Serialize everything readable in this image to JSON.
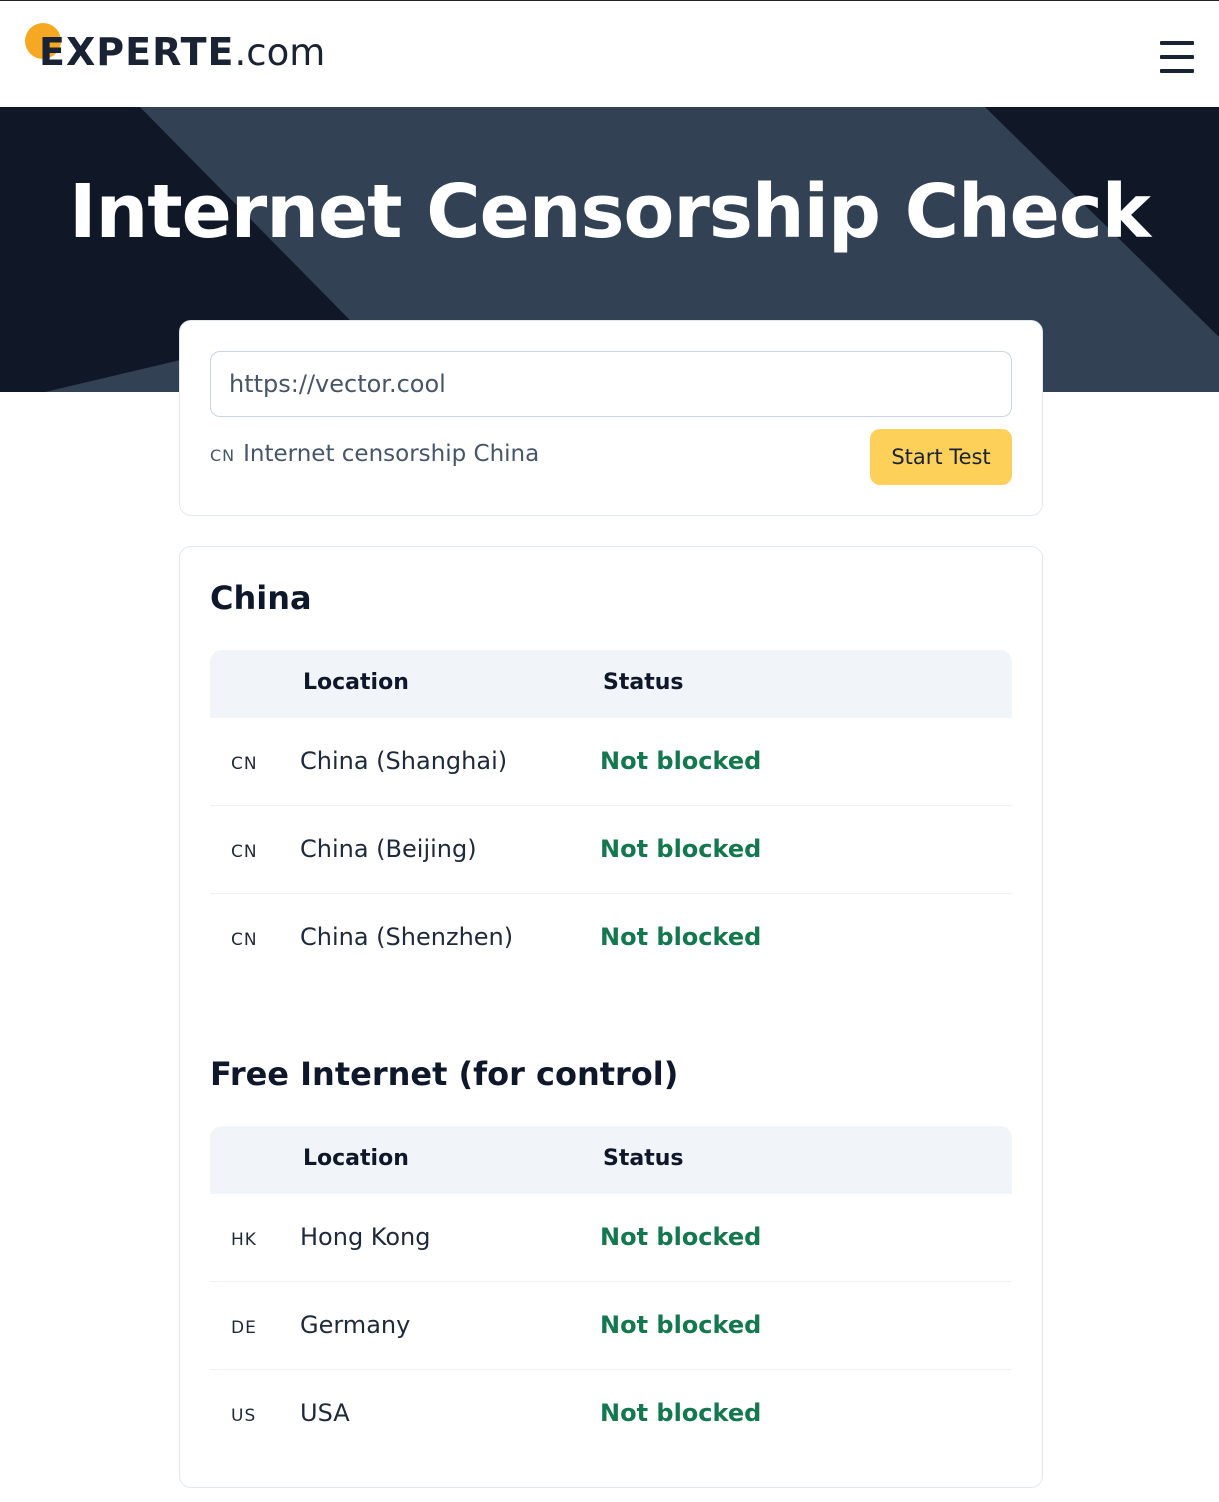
{
  "header": {
    "logo_word": "EXPERTE",
    "logo_domain": ".com",
    "menu_icon": "hamburger-menu-icon"
  },
  "hero": {
    "title": "Internet Censorship Check"
  },
  "search": {
    "url_value": "https://vector.cool",
    "region_code": "CN",
    "region_label": "Internet censorship China",
    "start_label": "Start Test"
  },
  "colors": {
    "accent": "#fdd05a",
    "hero_bg": "#334155",
    "status_ok": "#14784f",
    "logo_dot": "#f7a823"
  },
  "sections": [
    {
      "title": "China",
      "col_location": "Location",
      "col_status": "Status",
      "rows": [
        {
          "code": "CN",
          "location": "China (Shanghai)",
          "status": "Not blocked"
        },
        {
          "code": "CN",
          "location": "China (Beijing)",
          "status": "Not blocked"
        },
        {
          "code": "CN",
          "location": "China (Shenzhen)",
          "status": "Not blocked"
        }
      ]
    },
    {
      "title": "Free Internet (for control)",
      "col_location": "Location",
      "col_status": "Status",
      "rows": [
        {
          "code": "HK",
          "location": "Hong Kong",
          "status": "Not blocked"
        },
        {
          "code": "DE",
          "location": "Germany",
          "status": "Not blocked"
        },
        {
          "code": "US",
          "location": "USA",
          "status": "Not blocked"
        }
      ]
    }
  ]
}
